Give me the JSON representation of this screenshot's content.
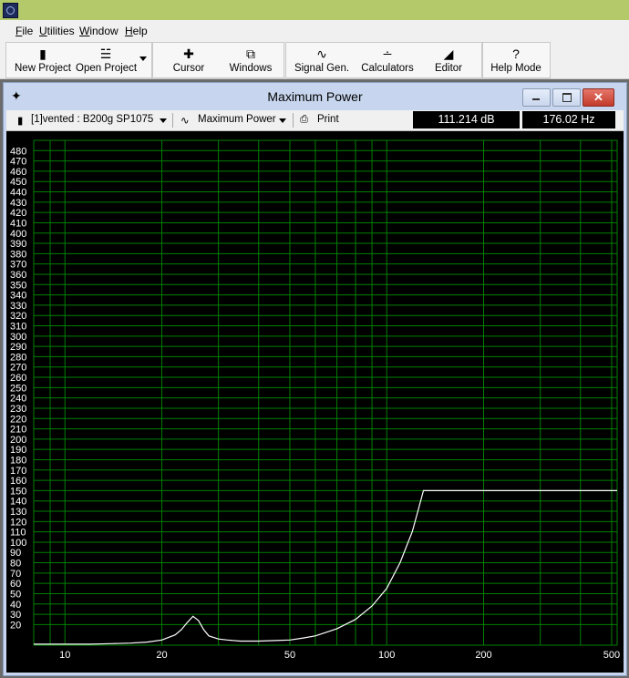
{
  "app": {
    "icon": "app-icon"
  },
  "menu": {
    "items": [
      {
        "label": "File",
        "key": "F"
      },
      {
        "label": "Utilities",
        "key": "U"
      },
      {
        "label": "Window",
        "key": "W"
      },
      {
        "label": "Help",
        "key": "H"
      }
    ]
  },
  "toolbar": {
    "new_project": {
      "label": "New Project",
      "icon": "new-project-icon"
    },
    "open_project": {
      "label": "Open Project",
      "icon": "open-folder-icon"
    },
    "cursor": {
      "label": "Cursor",
      "icon": "crosshair-icon"
    },
    "windows": {
      "label": "Windows",
      "icon": "windows-icon"
    },
    "signal_gen": {
      "label": "Signal Gen.",
      "icon": "sine-wave-icon"
    },
    "calculators": {
      "label": "Calculators",
      "icon": "calculator-icon"
    },
    "editor": {
      "label": "Editor",
      "icon": "speaker-icon"
    },
    "help_mode": {
      "label": "Help Mode",
      "icon": "question-icon"
    }
  },
  "window": {
    "title": "Maximum Power",
    "project_select": "[1]vented : B200g SP1075",
    "graph_select": "Maximum Power",
    "print_label": "Print",
    "readout_db": "111.214 dB",
    "readout_hz": "176.02 Hz"
  },
  "colors": {
    "grid": "#008000",
    "curve": "#ffffff",
    "background": "#000000",
    "titlebar": "#b4c96a"
  },
  "chart_data": {
    "type": "line",
    "title": "Maximum Power",
    "x_scale": "log",
    "xlim": [
      8,
      520
    ],
    "ylim": [
      0,
      490
    ],
    "x_ticks": [
      10,
      20,
      50,
      100,
      200,
      500
    ],
    "y_ticks": [
      20,
      30,
      40,
      50,
      60,
      70,
      80,
      90,
      100,
      110,
      120,
      130,
      140,
      150,
      160,
      170,
      180,
      190,
      200,
      210,
      220,
      230,
      240,
      250,
      260,
      270,
      280,
      290,
      300,
      310,
      320,
      330,
      340,
      350,
      360,
      370,
      380,
      390,
      400,
      410,
      420,
      430,
      440,
      450,
      460,
      470,
      480
    ],
    "grid": true,
    "series": [
      {
        "x": [
          8,
          10,
          12,
          14,
          16,
          18,
          20,
          22,
          23,
          24,
          25,
          26,
          27,
          28,
          30,
          32,
          35,
          40,
          45,
          50,
          55,
          60,
          70,
          80,
          90,
          100,
          110,
          120,
          125,
          130,
          150,
          200,
          300,
          400,
          520
        ],
        "y": [
          1,
          1,
          1,
          1.5,
          2,
          3,
          5,
          10,
          15,
          22,
          28,
          24,
          15,
          9,
          6,
          5,
          4,
          4,
          4.5,
          5,
          7,
          9,
          16,
          25,
          38,
          55,
          80,
          110,
          130,
          150,
          150,
          150,
          150,
          150,
          150
        ]
      }
    ]
  }
}
